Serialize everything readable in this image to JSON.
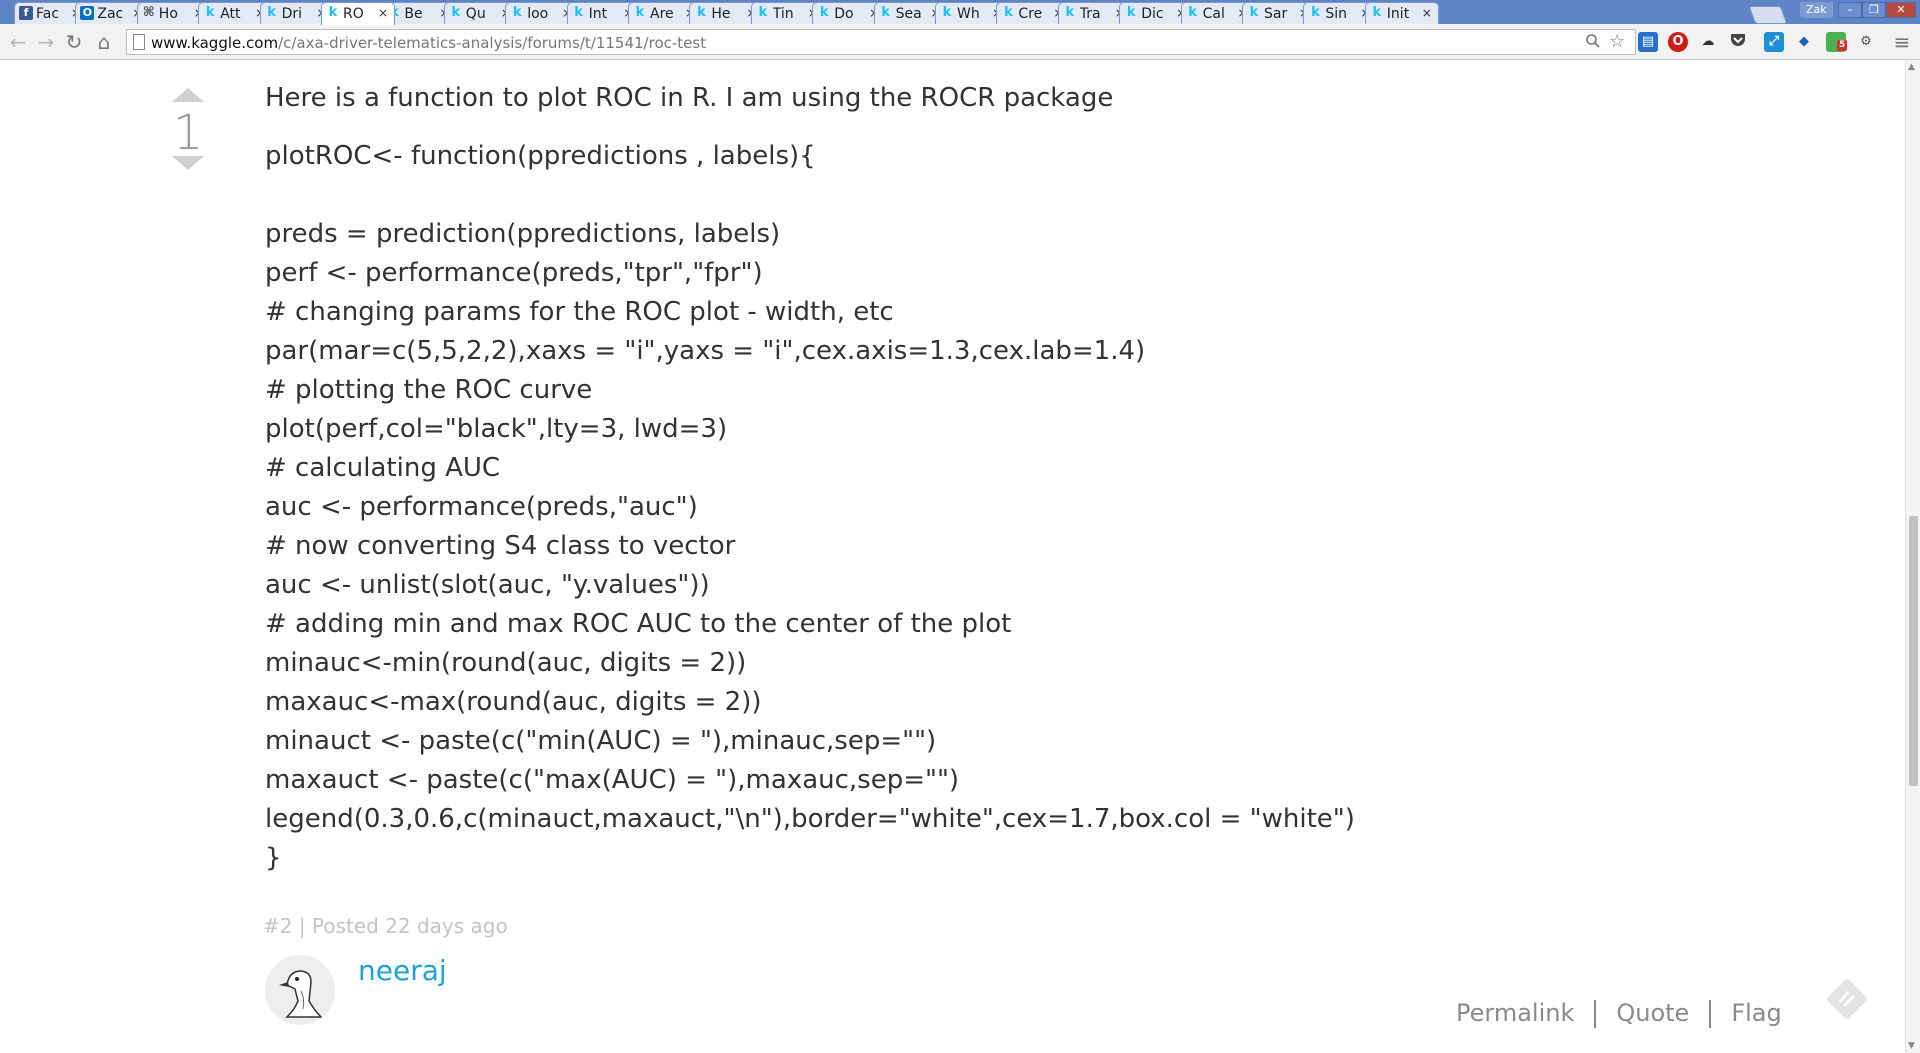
{
  "tabs": [
    {
      "label": "Fac",
      "favicon": "facebook-icon"
    },
    {
      "label": "Zac",
      "favicon": "outlook-icon"
    },
    {
      "label": "Ho",
      "favicon": "github-icon"
    },
    {
      "label": "Att",
      "favicon": "kaggle-icon"
    },
    {
      "label": "Dri",
      "favicon": "kaggle-icon"
    },
    {
      "label": "RO",
      "favicon": "kaggle-icon",
      "active": true
    },
    {
      "label": "Be",
      "favicon": "kaggle-icon"
    },
    {
      "label": "Qu",
      "favicon": "kaggle-icon"
    },
    {
      "label": "loo",
      "favicon": "kaggle-icon"
    },
    {
      "label": "Int",
      "favicon": "kaggle-icon"
    },
    {
      "label": "Are",
      "favicon": "kaggle-icon"
    },
    {
      "label": "He",
      "favicon": "kaggle-icon"
    },
    {
      "label": "Tin",
      "favicon": "kaggle-icon"
    },
    {
      "label": "Do",
      "favicon": "kaggle-icon"
    },
    {
      "label": "Sea",
      "favicon": "kaggle-icon"
    },
    {
      "label": "Wh",
      "favicon": "kaggle-icon"
    },
    {
      "label": "Cre",
      "favicon": "kaggle-icon"
    },
    {
      "label": "Tra",
      "favicon": "kaggle-icon"
    },
    {
      "label": "Dic",
      "favicon": "kaggle-icon"
    },
    {
      "label": "Cal",
      "favicon": "kaggle-icon"
    },
    {
      "label": "Sar",
      "favicon": "kaggle-icon"
    },
    {
      "label": "Sin",
      "favicon": "kaggle-icon"
    },
    {
      "label": "Init",
      "favicon": "kaggle-icon"
    }
  ],
  "tab_close_glyph": "×",
  "profile_name": "Zak",
  "window_controls": {
    "minimize": "–",
    "restore": "❐",
    "close": "✕"
  },
  "toolbar": {
    "back_glyph": "←",
    "forward_glyph": "→",
    "reload_glyph": "↻",
    "home_glyph": "⌂",
    "menu_glyph": "≡",
    "url_host": "www.kaggle.com",
    "url_path": "/c/axa-driver-telematics-analysis/forums/t/11541/roc-test",
    "extensions": [
      "mail-icon",
      "opera-icon",
      "cloud-icon",
      "pocket-icon",
      "resize-icon",
      "dropbox-icon",
      "chrome-ext-icon",
      "settings-ext-icon"
    ],
    "extension_badge": "5"
  },
  "post": {
    "vote_count": "1",
    "intro": "Here is a function to plot ROC in R. I am using the ROCR package",
    "code_lines": [
      "plotROC<- function(ppredictions , labels){",
      "",
      "preds = prediction(ppredictions, labels)",
      "perf <- performance(preds,\"tpr\",\"fpr\")",
      "# changing params for the ROC plot - width, etc",
      "par(mar=c(5,5,2,2),xaxs = \"i\",yaxs = \"i\",cex.axis=1.3,cex.lab=1.4)",
      "# plotting the ROC curve",
      "plot(perf,col=\"black\",lty=3, lwd=3)",
      "# calculating AUC",
      "auc <- performance(preds,\"auc\")",
      "# now converting S4 class to vector",
      "auc <- unlist(slot(auc, \"y.values\"))",
      "# adding min and max ROC AUC to the center of the plot",
      "minauc<-min(round(auc, digits = 2))",
      "maxauc<-max(round(auc, digits = 2))",
      "minauct <- paste(c(\"min(AUC) = \"),minauc,sep=\"\")",
      "maxauct <- paste(c(\"max(AUC) = \"),maxauc,sep=\"\")",
      "legend(0.3,0.6,c(minauct,maxauct,\"\\n\"),border=\"white\",cex=1.7,box.col = \"white\")",
      "}"
    ],
    "meta": "#2 | Posted 22 days ago",
    "author": "neeraj",
    "actions": {
      "permalink": "Permalink",
      "quote": "Quote",
      "flag": "Flag"
    }
  },
  "colors": {
    "tab_bar": "#5f83c7",
    "link": "#20a2d7",
    "text": "#333333",
    "muted": "#c4c4c4"
  }
}
